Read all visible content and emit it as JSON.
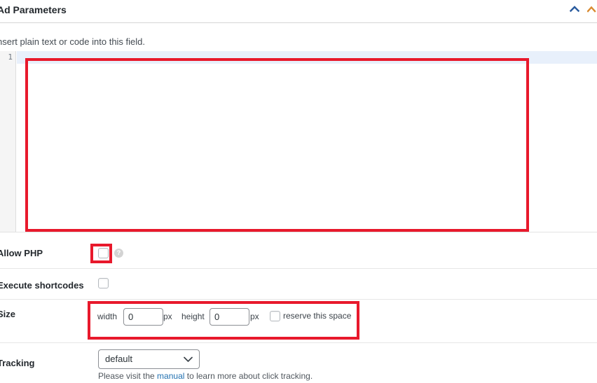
{
  "header": {
    "title": "Ad Parameters",
    "collapse_icon": "chevron-up-icon",
    "extra_icon": "chevron-up-icon-partial"
  },
  "editor": {
    "help_text": "nsert plain text or code into this field.",
    "line_number": "1",
    "content": "",
    "placeholder": ""
  },
  "rows": {
    "allow_php": {
      "label": "Allow PHP",
      "checkbox_checked": false,
      "help_icon_glyph": "?",
      "help_icon_name": "question-mark-icon"
    },
    "execute_shortcodes": {
      "label": "Execute shortcodes",
      "checkbox_checked": false
    },
    "size": {
      "label": "Size",
      "width_label": "width",
      "width_value": "0",
      "width_unit": "px",
      "height_label": "height",
      "height_value": "0",
      "height_unit": "px",
      "reserve_label": "reserve this space",
      "reserve_checked": false
    },
    "tracking": {
      "label": "Tracking",
      "selected_option": "default",
      "options": [
        "default"
      ],
      "note_before": "Please visit the ",
      "note_link": "manual",
      "note_after": " to learn more about click tracking."
    }
  },
  "annotations": {
    "color": "#e8192c",
    "boxes": [
      "editor-area",
      "allow-php-checkbox",
      "size-fields"
    ]
  },
  "colors": {
    "accent_link": "#2271b1",
    "annotation_red": "#e8192c",
    "active_line": "#e8f0fb",
    "gutter_bg": "#f5f5f5",
    "text": "#23282d"
  }
}
